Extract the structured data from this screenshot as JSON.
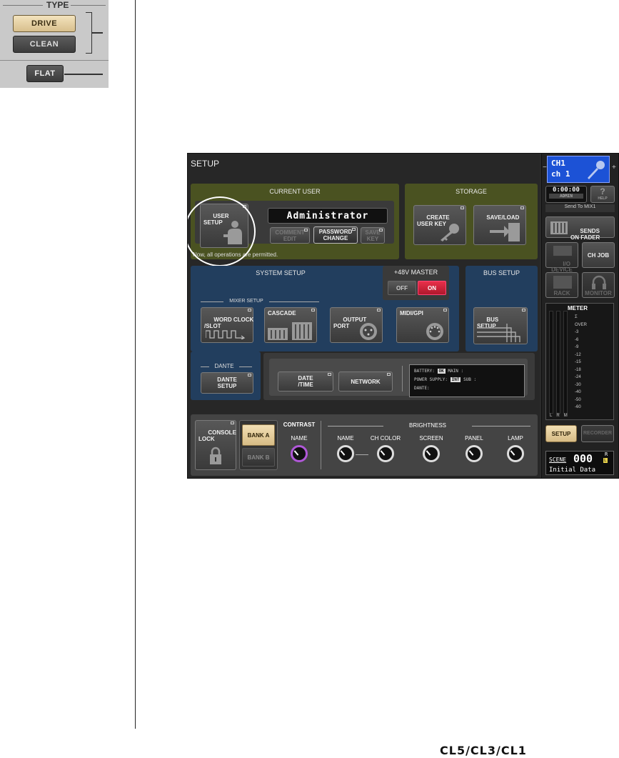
{
  "type_panel": {
    "title": "TYPE",
    "drive_label": "DRIVE",
    "clean_label": "CLEAN",
    "flat_label": "FLAT"
  },
  "screen": {
    "title": "SETUP",
    "current_user": {
      "title": "CURRENT USER",
      "user_setup_label": "USER\nSETUP",
      "user_name": "Administrator",
      "comment_edit_label": "COMMENT\nEDIT",
      "password_change_label": "PASSWORD\nCHANGE",
      "save_key_label": "SAVE\nKEY",
      "permission_text": "Now, all operations are permitted."
    },
    "storage": {
      "title": "STORAGE",
      "create_user_key_label": "CREATE\nUSER KEY",
      "save_load_label": "SAVE/LOAD"
    },
    "system_setup": {
      "title": "SYSTEM SETUP",
      "master_48v_title": "+48V MASTER",
      "off_label": "OFF",
      "on_label": "ON",
      "mixer_setup_label": "MIXER SETUP",
      "word_clock_label": "WORD CLOCK\n/SLOT",
      "cascade_label": "CASCADE",
      "output_port_label": "OUTPUT\nPORT",
      "midi_gpi_label": "MIDI/GPI",
      "dante_label": "DANTE",
      "dante_setup_label": "DANTE\nSETUP",
      "date_time_label": "DATE\n/TIME",
      "network_label": "NETWORK",
      "info": {
        "battery_label": "BATTERY:",
        "battery_value": "OK",
        "main_label": "MAIN :",
        "power_supply_label": "POWER SUPPLY:",
        "power_supply_value": "INT",
        "sub_label": "SUB :",
        "dante_label": "DANTE:"
      }
    },
    "bus_setup": {
      "title": "BUS SETUP",
      "bus_setup_label": "BUS\nSETUP"
    },
    "bottom": {
      "console_lock_label": "CONSOLE\nLOCK",
      "bank_a_label": "BANK A",
      "bank_b_label": "BANK B",
      "contrast_title": "CONTRAST",
      "brightness_title": "BRIGHTNESS",
      "contrast_knobs": [
        "NAME"
      ],
      "brightness_knobs": [
        "NAME",
        "CH COLOR",
        "SCREEN",
        "PANEL",
        "LAMP"
      ]
    },
    "side": {
      "channel_line1": "CH1",
      "channel_line2": "ch 1",
      "time": "0:00:00",
      "user": "ADMIN",
      "help_label": "HELP",
      "send_to": "Send To MIX1",
      "sends_on_fader_label": "SENDS\nON FADER",
      "io_device_label": "I/O\nDEVICE",
      "ch_job_label": "CH JOB",
      "rack_label": "RACK",
      "monitor_label": "MONITOR",
      "meter_title": "METER",
      "meter_scale": [
        "Σ",
        "OVER",
        "-3",
        "-6",
        "-9",
        "-12",
        "-15",
        "-18",
        "-24",
        "-30",
        "-40",
        "-50",
        "-60"
      ],
      "meter_channels": [
        "L",
        "R",
        "M"
      ],
      "setup_label": "SETUP",
      "recorder_label": "RECORDER",
      "scene_label": "SCENE",
      "scene_number": "000",
      "scene_r": "R",
      "scene_l": "L",
      "scene_name": "Initial Data"
    }
  },
  "footer": {
    "model_logo": "CL5/CL3/CL1"
  }
}
